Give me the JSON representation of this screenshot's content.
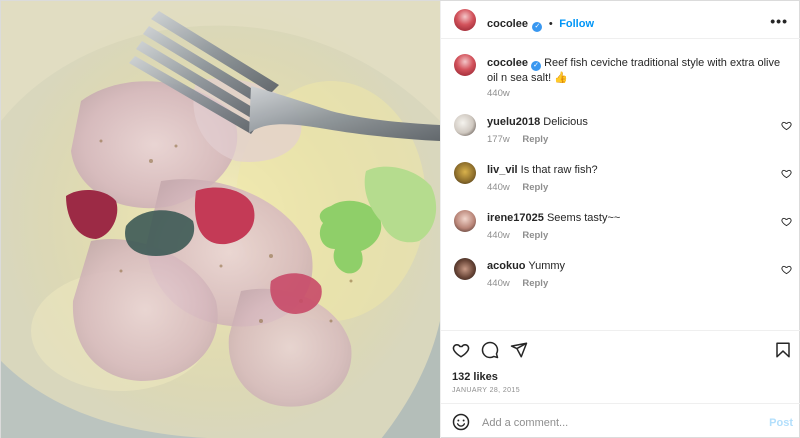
{
  "post": {
    "author": "cocolee",
    "verified": true,
    "follow_label": "Follow",
    "separator": "•",
    "more_label": "•••",
    "caption": "Reef fish ceviche traditional style with extra olive oil n sea salt! 👍",
    "caption_age": "440w"
  },
  "comments": [
    {
      "user": "yuelu2018",
      "text": "Delicious",
      "age": "177w",
      "reply_label": "Reply"
    },
    {
      "user": "liv_vil",
      "text": "Is that raw fish?",
      "age": "440w",
      "reply_label": "Reply"
    },
    {
      "user": "irene17025",
      "text": "Seems tasty~~",
      "age": "440w",
      "reply_label": "Reply"
    },
    {
      "user": "acokuo",
      "text": "Yummy",
      "age": "440w",
      "reply_label": "Reply"
    }
  ],
  "stats": {
    "likes": "132 likes",
    "date": "JANUARY 28, 2015"
  },
  "composer": {
    "placeholder": "Add a comment...",
    "post_label": "Post"
  },
  "icons": {
    "heart": "heart-icon",
    "comment": "comment-icon",
    "share": "share-icon",
    "save": "bookmark-icon",
    "emoji": "emoji-icon",
    "more": "more-options-icon",
    "verified": "verified-badge-icon"
  },
  "colors": {
    "accent": "#0095f6",
    "verified": "#3897f0",
    "muted": "#8e8e8e"
  }
}
